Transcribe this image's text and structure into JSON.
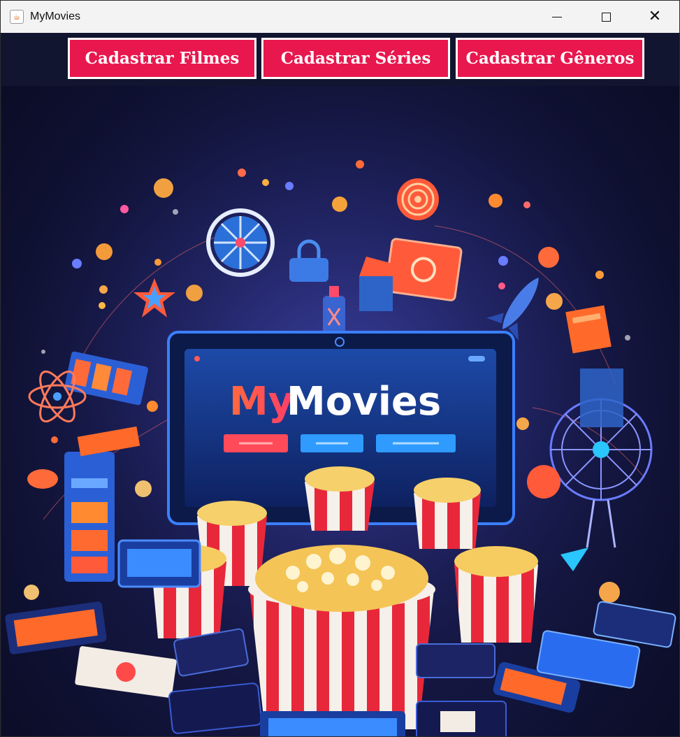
{
  "window": {
    "title": "MyMovies",
    "icon": "java-cup-icon"
  },
  "nav": {
    "cadastrar_filmes": "Cadastrar Filmes",
    "cadastrar_series": "Cadastrar Séries",
    "cadastrar_generos": "Cadastrar Gêneros"
  },
  "banner": {
    "logo_my": "My",
    "logo_movies": "Movies"
  },
  "colors": {
    "button_bg": "#e8174e",
    "button_border": "#ffffff",
    "background": "#12163a",
    "accent_blue": "#2f9bff",
    "accent_orange": "#ff7a3a"
  }
}
